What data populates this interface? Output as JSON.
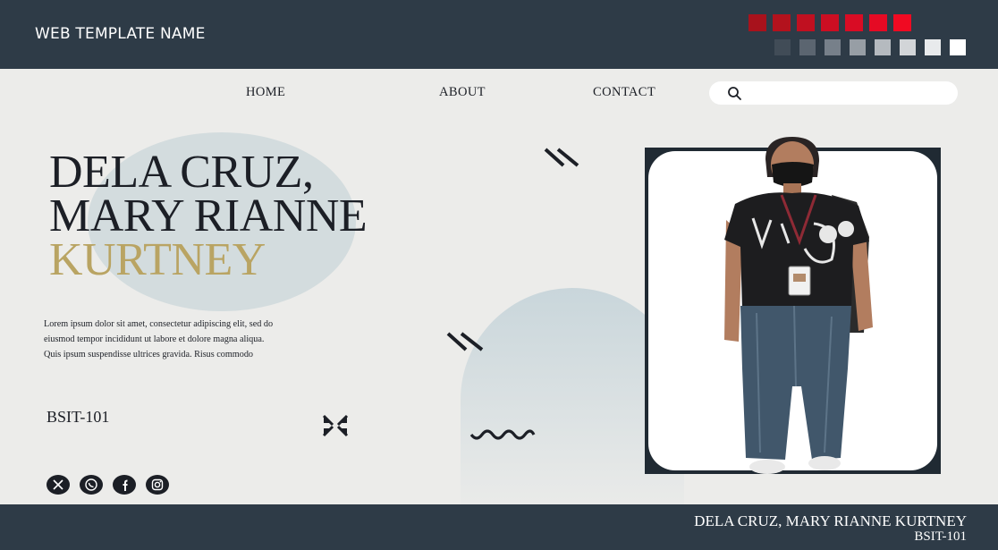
{
  "header": {
    "site_title": "WEB TEMPLATE NAME",
    "palette_red": [
      "#a8121c",
      "#b3121d",
      "#c01020",
      "#cc0e22",
      "#d90c24",
      "#e50a24",
      "#f00a22"
    ],
    "palette_gray": [
      "#414c57",
      "#5b6570",
      "#77808a",
      "#979ea5",
      "#b5babf",
      "#d2d5d8",
      "#e8eaec",
      "#ffffff"
    ]
  },
  "nav": {
    "items": [
      "HOME",
      "ABOUT",
      "CONTACT"
    ],
    "search_placeholder": ""
  },
  "hero": {
    "name_line1": "DELA CRUZ,",
    "name_line2": "MARY RIANNE",
    "name_line3": "KURTNEY",
    "description_line1": "Lorem ipsum dolor sit amet, consectetur adipiscing elit, sed do",
    "description_line2": "eiusmod tempor incididunt ut labore et dolore magna aliqua.",
    "description_line3": "Quis ipsum suspendisse ultrices gravida. Risus commodo",
    "section": "BSIT-101",
    "accent_color": "#b9a463"
  },
  "social": {
    "icons": [
      "x-icon",
      "whatsapp-icon",
      "facebook-icon",
      "instagram-icon"
    ]
  },
  "footer": {
    "name": "DELA CRUZ, MARY RIANNE KURTNEY",
    "section": "BSIT-101"
  }
}
